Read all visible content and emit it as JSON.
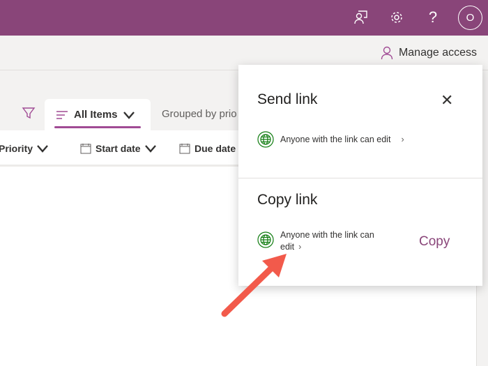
{
  "topbar": {
    "avatar_initial": "O",
    "icons": [
      "feedback-icon",
      "gear-icon",
      "help-icon"
    ],
    "help_glyph": "?",
    "color": "#894579"
  },
  "subbar": {
    "manage_access": "Manage access"
  },
  "views": {
    "active_tab": "All Items",
    "other_tab": "Grouped by prio"
  },
  "columns": [
    "Priority",
    "Start date",
    "Due date"
  ],
  "share_panel": {
    "send_title": "Send link",
    "send_permission": "Anyone with the link can edit",
    "copy_title": "Copy link",
    "copy_permission_line1": "Anyone with the link can",
    "copy_permission_line2": "edit",
    "copy_button": "Copy",
    "accent": "#894579",
    "globe_color": "#107c10"
  },
  "annotation": {
    "arrow_color": "#f25a4b"
  }
}
